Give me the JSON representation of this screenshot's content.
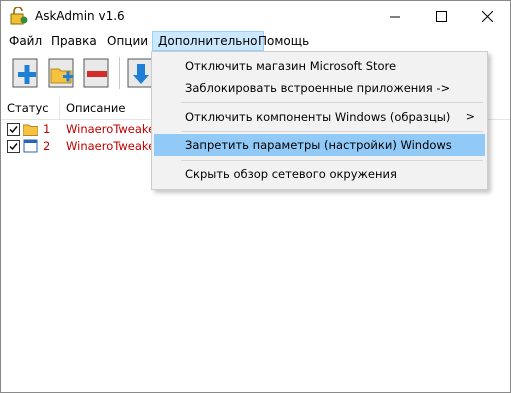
{
  "window": {
    "title": "AskAdmin v1.6"
  },
  "menubar": {
    "items": [
      "Файл",
      "Правка",
      "Опции",
      "Дополнительно",
      "Помощь"
    ],
    "active": "Дополнительно"
  },
  "toolbar": {
    "buttons": [
      "add-file-icon",
      "add-folder-icon",
      "remove-icon",
      "import-icon"
    ]
  },
  "table": {
    "columns": [
      "Статус",
      "Описание"
    ],
    "rows": [
      {
        "num": "1",
        "desc": "WinaeroTweaker",
        "checked": true,
        "icon": "folder-icon"
      },
      {
        "num": "2",
        "desc": "WinaeroTweaker",
        "checked": true,
        "icon": "window-icon"
      }
    ]
  },
  "dropdown": {
    "items": [
      "Отключить магазин Microsoft Store",
      "Заблокировать встроенные приложения ->",
      "Отключить компоненты Windows (образцы)",
      "Запретить параметры (настройки) Windows",
      "Скрыть обзор сетевого окружения"
    ],
    "submenu_arrow": ">"
  },
  "colors": {
    "highlight": "#91c9f7",
    "menu_active": "#cce8ff",
    "row_text": "#c00000"
  }
}
